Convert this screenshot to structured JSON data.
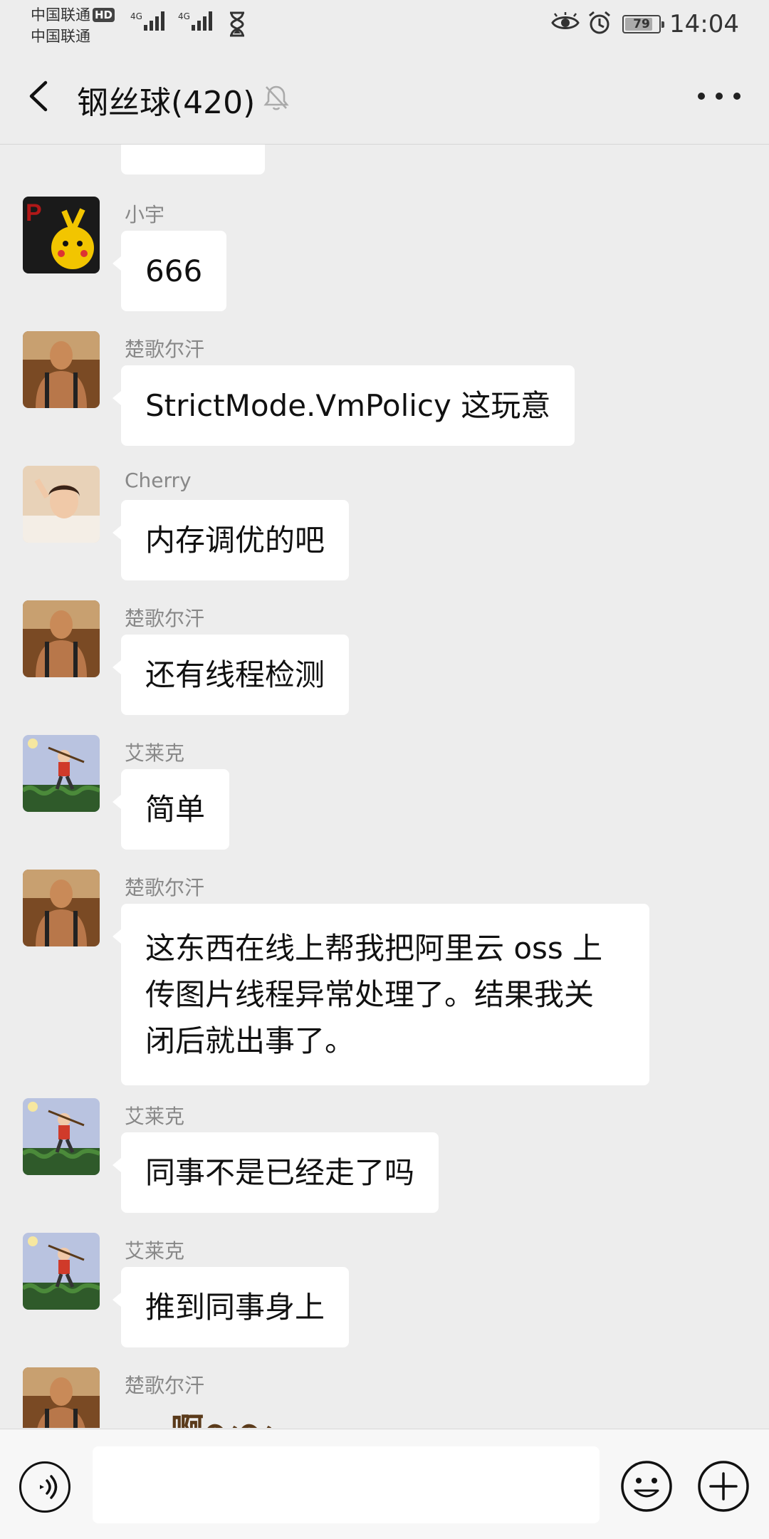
{
  "status_bar": {
    "carrier_1": "中国联通",
    "carrier_2": "中国联通",
    "hd_badge": "HD",
    "network_1": "4G",
    "network_2": "4G",
    "battery": "79",
    "battery_level": 0.79,
    "time": "14:04"
  },
  "header": {
    "title": "钢丝球(420)",
    "icons": {
      "back": "back-arrow-icon",
      "mute": "bell-muted-icon",
      "more": "more-dots-icon"
    }
  },
  "messages": [
    {
      "sender": "小宇",
      "text": "666"
    },
    {
      "sender": "楚歌尔汗",
      "text": "StrictMode.VmPolicy 这玩意"
    },
    {
      "sender": "Cherry",
      "text": "内存调优的吧"
    },
    {
      "sender": "楚歌尔汗",
      "text": "还有线程检测"
    },
    {
      "sender": "艾莱克",
      "text": "简单"
    },
    {
      "sender": "楚歌尔汗",
      "lines": [
        "这东西在线上帮我把阿里云 oss 上",
        "传图片线程异常处理了。结果我关",
        "闭后就出事了。"
      ]
    },
    {
      "sender": "艾莱克",
      "text": "同事不是已经走了吗"
    },
    {
      "sender": "艾莱克",
      "text": "推到同事身上"
    },
    {
      "sender": "楚歌尔汗",
      "sticker": "啊～～"
    }
  ],
  "input_bar": {
    "value": "",
    "icons": {
      "voice": "voice-icon",
      "emoji": "emoji-icon",
      "plus": "plus-icon"
    }
  }
}
